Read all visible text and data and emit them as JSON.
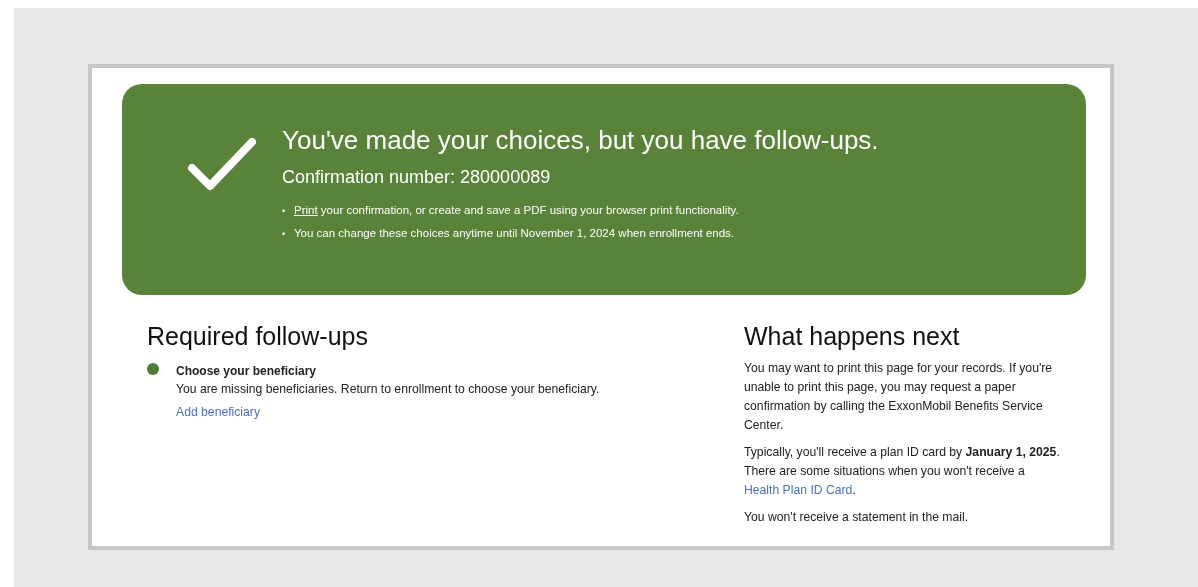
{
  "banner": {
    "title": "You've made your choices, but you have follow-ups.",
    "confirmation": "Confirmation number: 280000089",
    "bullets": [
      {
        "marker": "•",
        "link": "Print",
        "text": " your confirmation, or create and save a PDF using your browser print functionality."
      },
      {
        "marker": "•",
        "text": "You can change these choices anytime until November 1, 2024 when enrollment ends."
      }
    ]
  },
  "followups": {
    "heading": "Required follow-ups",
    "items": [
      {
        "color": "#4e7d36",
        "title": "Choose your beneficiary",
        "description": "You are missing beneficiaries. Return to enrollment to choose your beneficiary.",
        "link": "Add beneficiary"
      }
    ]
  },
  "next": {
    "heading": "What happens next",
    "paragraphs": [
      {
        "text": "You may want to print this page for your records. If you're unable to print this page, you may request a paper confirmation by calling the ExxonMobil Benefits Service Center."
      },
      {
        "text": "Typically, you'll receive a plan ID card by **January 1, 2025**. There are some situations when you won't receive a",
        "link": "Health Plan ID Card",
        "after": "."
      },
      {
        "text": "You won't receive a statement in the mail."
      }
    ]
  }
}
